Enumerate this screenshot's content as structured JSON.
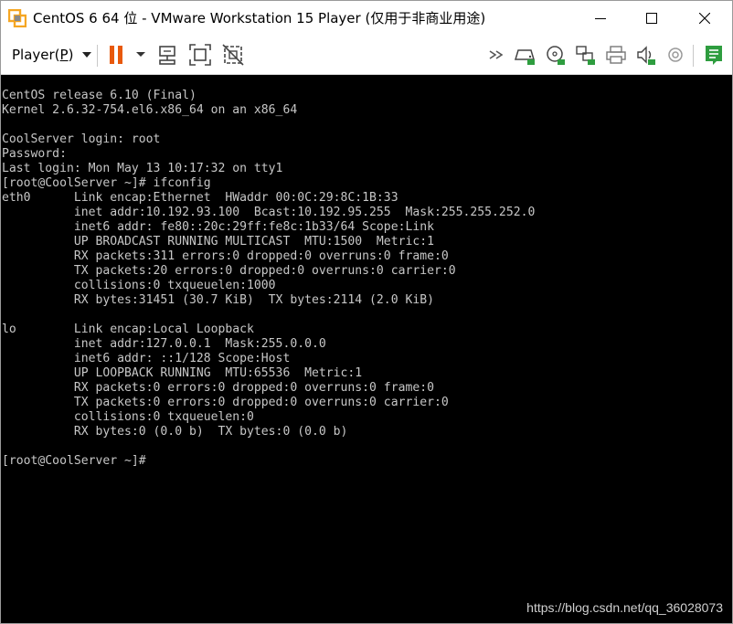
{
  "window": {
    "title": "CentOS 6 64 位 - VMware Workstation 15 Player (仅用于非商业用途)"
  },
  "toolbar": {
    "player_menu_label": "Player(",
    "player_menu_hotkey": "P",
    "player_menu_close": ")",
    "icons": [
      "pause-icon",
      "send-ctrl-alt-del-icon",
      "fit-guest-icon",
      "unity-mode-icon",
      "more-devices-icon",
      "hard-disk-icon",
      "cd-dvd-icon",
      "network-adapter-icon",
      "printer-icon",
      "sound-card-icon",
      "usb-device-icon",
      "message-log-icon"
    ],
    "pause_color": "#e8590c",
    "message_color": "#2e9d3f"
  },
  "console": {
    "lines": [
      "CentOS release 6.10 (Final)",
      "Kernel 2.6.32-754.el6.x86_64 on an x86_64",
      "",
      "CoolServer login: root",
      "Password:",
      "Last login: Mon May 13 10:17:32 on tty1",
      "[root@CoolServer ~]# ifconfig",
      "eth0      Link encap:Ethernet  HWaddr 00:0C:29:8C:1B:33",
      "          inet addr:10.192.93.100  Bcast:10.192.95.255  Mask:255.255.252.0",
      "          inet6 addr: fe80::20c:29ff:fe8c:1b33/64 Scope:Link",
      "          UP BROADCAST RUNNING MULTICAST  MTU:1500  Metric:1",
      "          RX packets:311 errors:0 dropped:0 overruns:0 frame:0",
      "          TX packets:20 errors:0 dropped:0 overruns:0 carrier:0",
      "          collisions:0 txqueuelen:1000",
      "          RX bytes:31451 (30.7 KiB)  TX bytes:2114 (2.0 KiB)",
      "",
      "lo        Link encap:Local Loopback",
      "          inet addr:127.0.0.1  Mask:255.0.0.0",
      "          inet6 addr: ::1/128 Scope:Host",
      "          UP LOOPBACK RUNNING  MTU:65536  Metric:1",
      "          RX packets:0 errors:0 dropped:0 overruns:0 frame:0",
      "          TX packets:0 errors:0 dropped:0 overruns:0 carrier:0",
      "          collisions:0 txqueuelen:0",
      "          RX bytes:0 (0.0 b)  TX bytes:0 (0.0 b)",
      "",
      "[root@CoolServer ~]#"
    ],
    "watermark": "https://blog.csdn.net/qq_36028073"
  }
}
